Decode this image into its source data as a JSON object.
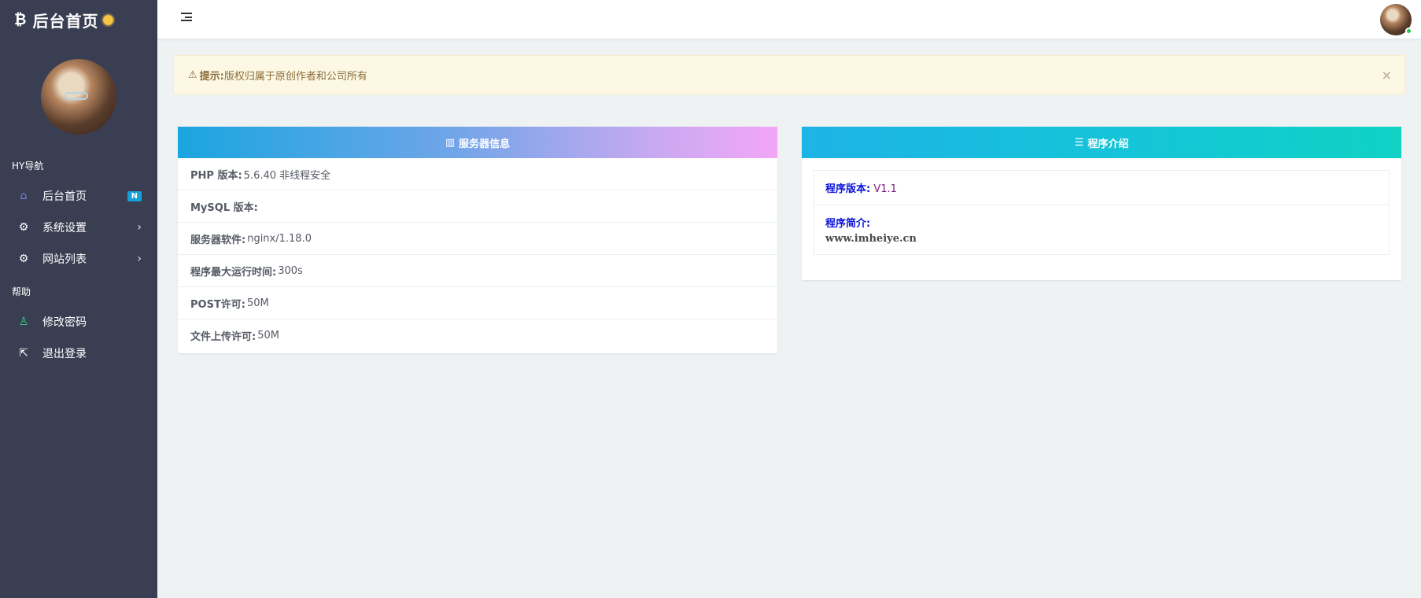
{
  "brand": {
    "title": "后台首页"
  },
  "sidebar": {
    "sections": [
      {
        "label": "HY导航"
      },
      {
        "label": "帮助"
      }
    ],
    "items": [
      {
        "label": "后台首页",
        "icon": "home-icon",
        "badge": "N"
      },
      {
        "label": "系统设置",
        "icon": "gear-icon"
      },
      {
        "label": "网站列表",
        "icon": "gear-icon"
      },
      {
        "label": "修改密码",
        "icon": "user-icon"
      },
      {
        "label": "退出登录",
        "icon": "logout-icon"
      }
    ]
  },
  "alert": {
    "prefix": "提示:",
    "message": "版权归属于原创作者和公司所有",
    "close": "×"
  },
  "server_card": {
    "title": "服务器信息",
    "icon": "bar-chart-icon",
    "rows": [
      {
        "key": "PHP 版本:",
        "value": "5.6.40 非线程安全"
      },
      {
        "key": "MySQL 版本:",
        "value": ""
      },
      {
        "key": "服务器软件:",
        "value": "nginx/1.18.0"
      },
      {
        "key": "程序最大运行时间:",
        "value": "300s"
      },
      {
        "key": "POST许可:",
        "value": "50M"
      },
      {
        "key": "文件上传许可:",
        "value": "50M"
      }
    ]
  },
  "program_card": {
    "title": "程序介绍",
    "icon": "list-icon",
    "version_key": "程序版本:",
    "version_value": "V1.1",
    "intro_key": "程序简介:",
    "intro_value": "www.imheiye.cn"
  },
  "colors": {
    "sidebar": "#3a3e52",
    "alert_bg": "#fcf8e3",
    "link_blue": "#0b14d9",
    "online": "#22c55e"
  }
}
